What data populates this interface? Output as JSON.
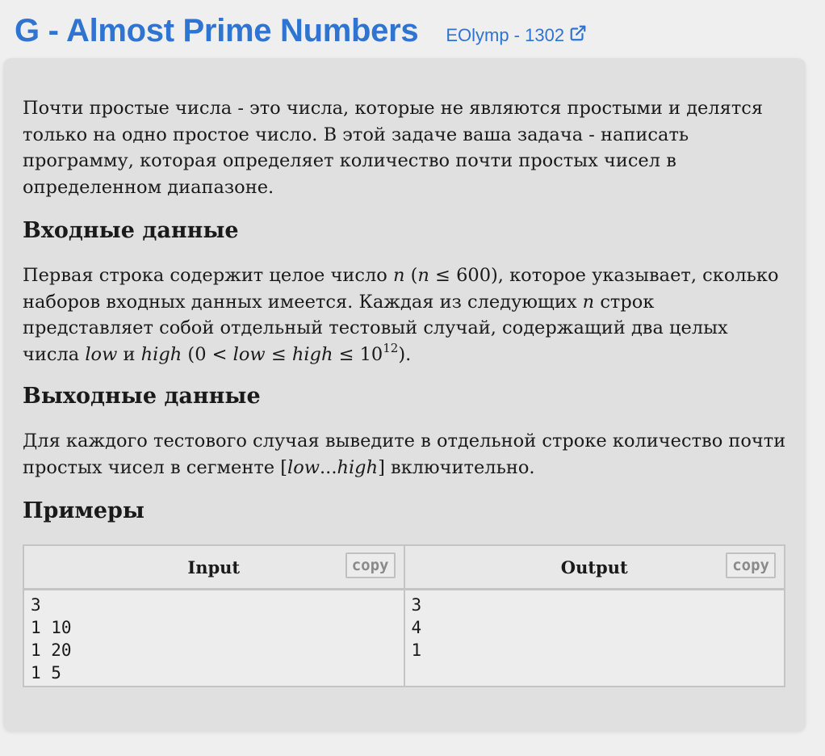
{
  "header": {
    "title": "G - Almost Prime Numbers",
    "source_link": "EOlymp - 1302",
    "external_link_icon": "external-link-icon"
  },
  "problem": {
    "statement": "Почти простые числа - это числа, которые не являются простыми и делятся только на одно простое число. В этой задаче ваша задача - написать программу, которая определяет количество почти простых чисел в определенном диапазоне.",
    "input_heading": "Входные данные",
    "input_text": {
      "part1": "Первая строка содержит целое число ",
      "var_n": "n",
      "cond_open": " (",
      "cond_var": "n",
      "cond_rest": " ≤ 600)",
      "part2": ", которое указывает, сколько наборов входных данных имеется. Каждая из следующих ",
      "var_n2": "n",
      "part3": " строк представляет собой отдельный тестовый случай, содержащий два целых числа ",
      "var_low": "low",
      "and": " и ",
      "var_high": "high",
      "range_open": " (0 < ",
      "range_low": "low",
      "range_le": " ≤ ",
      "range_high": "high",
      "range_le2": " ≤ 10",
      "range_exp": "12",
      "range_close": ")."
    },
    "output_heading": "Выходные данные",
    "output_text": {
      "part1": "Для каждого тестового случая выведите в отдельной строке количество почти простых чисел в сегменте ",
      "seg_open": "[",
      "seg_low": "low",
      "seg_dots": "...",
      "seg_high": "high",
      "seg_close": "]",
      "part2": " включительно."
    },
    "examples_heading": "Примеры"
  },
  "samples": {
    "input_header": "Input",
    "output_header": "Output",
    "copy_label": "copy",
    "input_value": "3\n1 10\n1 20\n1 5",
    "output_value": "3\n4\n1"
  }
}
